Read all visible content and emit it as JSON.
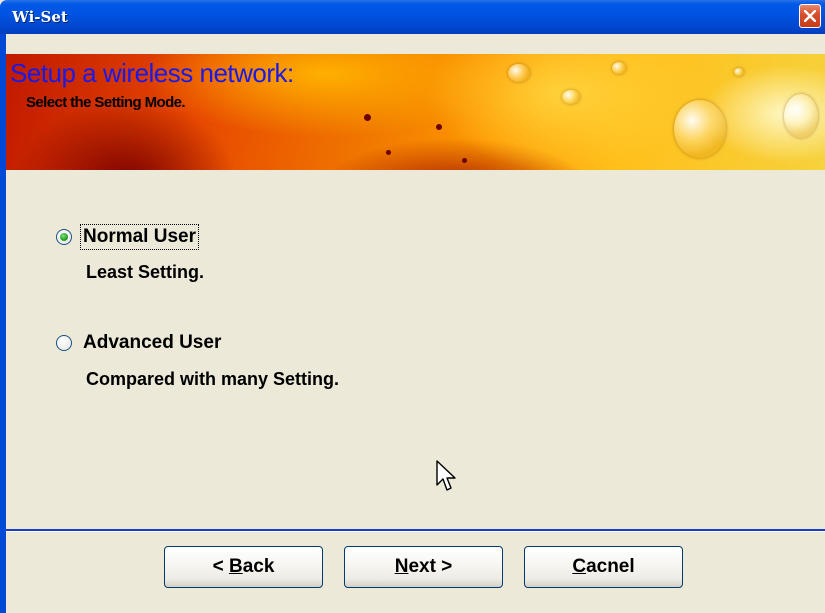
{
  "window": {
    "title": "Wi-Set"
  },
  "banner": {
    "title": "Setup a wireless network:",
    "subtitle": "Select the Setting Mode."
  },
  "options": [
    {
      "label": "Normal User",
      "description": "Least Setting.",
      "selected": true
    },
    {
      "label": "Advanced User",
      "description": "Compared with many Setting.",
      "selected": false
    }
  ],
  "buttons": {
    "back": {
      "prefix": "< ",
      "mnemonic": "B",
      "rest": "ack"
    },
    "next": {
      "mnemonic": "N",
      "rest": "ext >"
    },
    "cancel": {
      "mnemonic": "C",
      "rest": "acnel"
    }
  },
  "colors": {
    "titlebar": "#0054e3",
    "banner_title": "#1a1ae6",
    "dialog_bg": "#ece9d8",
    "separator": "#1a3dc8"
  }
}
